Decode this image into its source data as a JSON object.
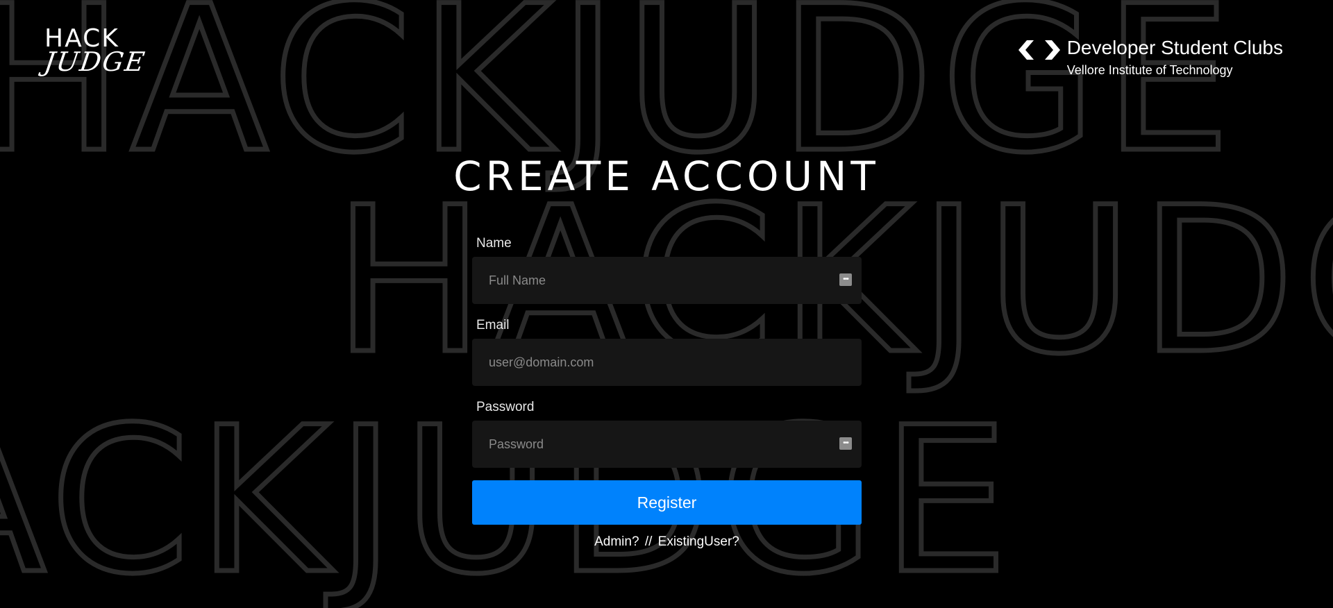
{
  "background": {
    "watermark_text": "HACKJUDGE"
  },
  "logo": {
    "line1": "HACK",
    "line2": "JUDGE"
  },
  "branding": {
    "icon": "dsc-brackets-icon",
    "title": "Developer Student Clubs",
    "subtitle": "Vellore Institute of Technology"
  },
  "page": {
    "heading": "Create Account"
  },
  "form": {
    "name": {
      "label": "Name",
      "placeholder": "Full Name",
      "value": "",
      "icon": "password-manager-icon"
    },
    "email": {
      "label": "Email",
      "placeholder": "user@domain.com",
      "value": ""
    },
    "password": {
      "label": "Password",
      "placeholder": "Password",
      "value": "",
      "icon": "password-manager-icon"
    },
    "register_label": "Register"
  },
  "footer_links": {
    "admin": "Admin?",
    "separator": "//",
    "existing_user": "ExistingUser?"
  },
  "colors": {
    "background": "#000000",
    "input_bg": "#161616",
    "accent": "#0082fc",
    "watermark_stroke": "#2a2a2a"
  }
}
